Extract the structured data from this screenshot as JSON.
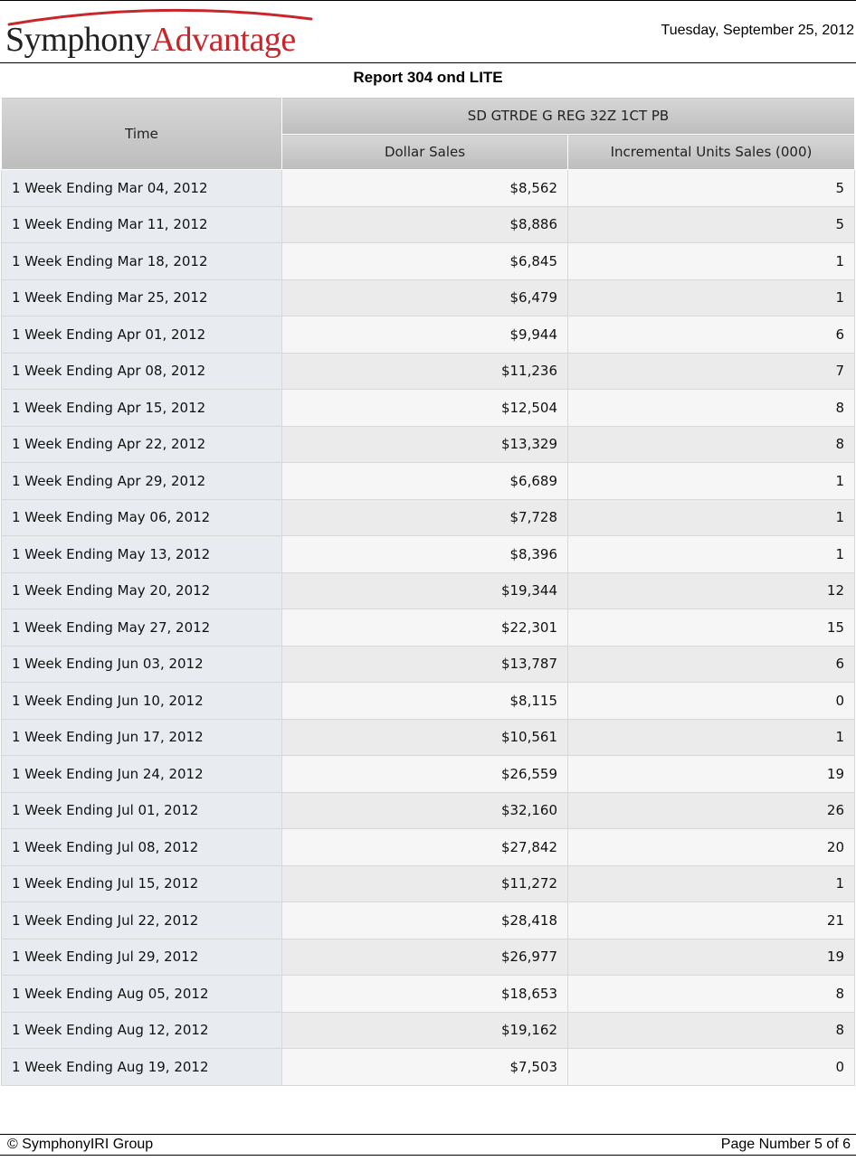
{
  "header": {
    "logo_part1": "Symphony",
    "logo_part2": "Advantage",
    "date": "Tuesday, September 25, 2012"
  },
  "report": {
    "title": "Report 304 ond LITE"
  },
  "table": {
    "time_header": "Time",
    "product_header": "SD GTRDE G REG 32Z 1CT PB",
    "columns": [
      "Dollar Sales",
      "Incremental Units Sales (000)"
    ],
    "rows": [
      {
        "time": "1 Week Ending Mar 04, 2012",
        "dollar_sales": "$8,562",
        "incremental_units": "5"
      },
      {
        "time": "1 Week Ending Mar 11, 2012",
        "dollar_sales": "$8,886",
        "incremental_units": "5"
      },
      {
        "time": "1 Week Ending Mar 18, 2012",
        "dollar_sales": "$6,845",
        "incremental_units": "1"
      },
      {
        "time": "1 Week Ending Mar 25, 2012",
        "dollar_sales": "$6,479",
        "incremental_units": "1"
      },
      {
        "time": "1 Week Ending Apr 01, 2012",
        "dollar_sales": "$9,944",
        "incremental_units": "6"
      },
      {
        "time": "1 Week Ending Apr 08, 2012",
        "dollar_sales": "$11,236",
        "incremental_units": "7"
      },
      {
        "time": "1 Week Ending Apr 15, 2012",
        "dollar_sales": "$12,504",
        "incremental_units": "8"
      },
      {
        "time": "1 Week Ending Apr 22, 2012",
        "dollar_sales": "$13,329",
        "incremental_units": "8"
      },
      {
        "time": "1 Week Ending Apr 29, 2012",
        "dollar_sales": "$6,689",
        "incremental_units": "1"
      },
      {
        "time": "1 Week Ending May 06, 2012",
        "dollar_sales": "$7,728",
        "incremental_units": "1"
      },
      {
        "time": "1 Week Ending May 13, 2012",
        "dollar_sales": "$8,396",
        "incremental_units": "1"
      },
      {
        "time": "1 Week Ending May 20, 2012",
        "dollar_sales": "$19,344",
        "incremental_units": "12"
      },
      {
        "time": "1 Week Ending May 27, 2012",
        "dollar_sales": "$22,301",
        "incremental_units": "15"
      },
      {
        "time": "1 Week Ending Jun 03, 2012",
        "dollar_sales": "$13,787",
        "incremental_units": "6"
      },
      {
        "time": "1 Week Ending Jun 10, 2012",
        "dollar_sales": "$8,115",
        "incremental_units": "0"
      },
      {
        "time": "1 Week Ending Jun 17, 2012",
        "dollar_sales": "$10,561",
        "incremental_units": "1"
      },
      {
        "time": "1 Week Ending Jun 24, 2012",
        "dollar_sales": "$26,559",
        "incremental_units": "19"
      },
      {
        "time": "1 Week Ending Jul 01, 2012",
        "dollar_sales": "$32,160",
        "incremental_units": "26"
      },
      {
        "time": "1 Week Ending Jul 08, 2012",
        "dollar_sales": "$27,842",
        "incremental_units": "20"
      },
      {
        "time": "1 Week Ending Jul 15, 2012",
        "dollar_sales": "$11,272",
        "incremental_units": "1"
      },
      {
        "time": "1 Week Ending Jul 22, 2012",
        "dollar_sales": "$28,418",
        "incremental_units": "21"
      },
      {
        "time": "1 Week Ending Jul 29, 2012",
        "dollar_sales": "$26,977",
        "incremental_units": "19"
      },
      {
        "time": "1 Week Ending Aug 05, 2012",
        "dollar_sales": "$18,653",
        "incremental_units": "8"
      },
      {
        "time": "1 Week Ending Aug 12, 2012",
        "dollar_sales": "$19,162",
        "incremental_units": "8"
      },
      {
        "time": "1 Week Ending Aug 19, 2012",
        "dollar_sales": "$7,503",
        "incremental_units": "0"
      }
    ]
  },
  "footer": {
    "copyright": "© SymphonyIRI Group",
    "page_number": "Page Number 5 of 6"
  },
  "colors": {
    "brand_red": "#c8262a",
    "brand_dark": "#222222",
    "header_gray": "#c9c9c9",
    "time_cell_bg": "#e8ebf0"
  },
  "icons": [
    "logo-swoosh-icon"
  ]
}
